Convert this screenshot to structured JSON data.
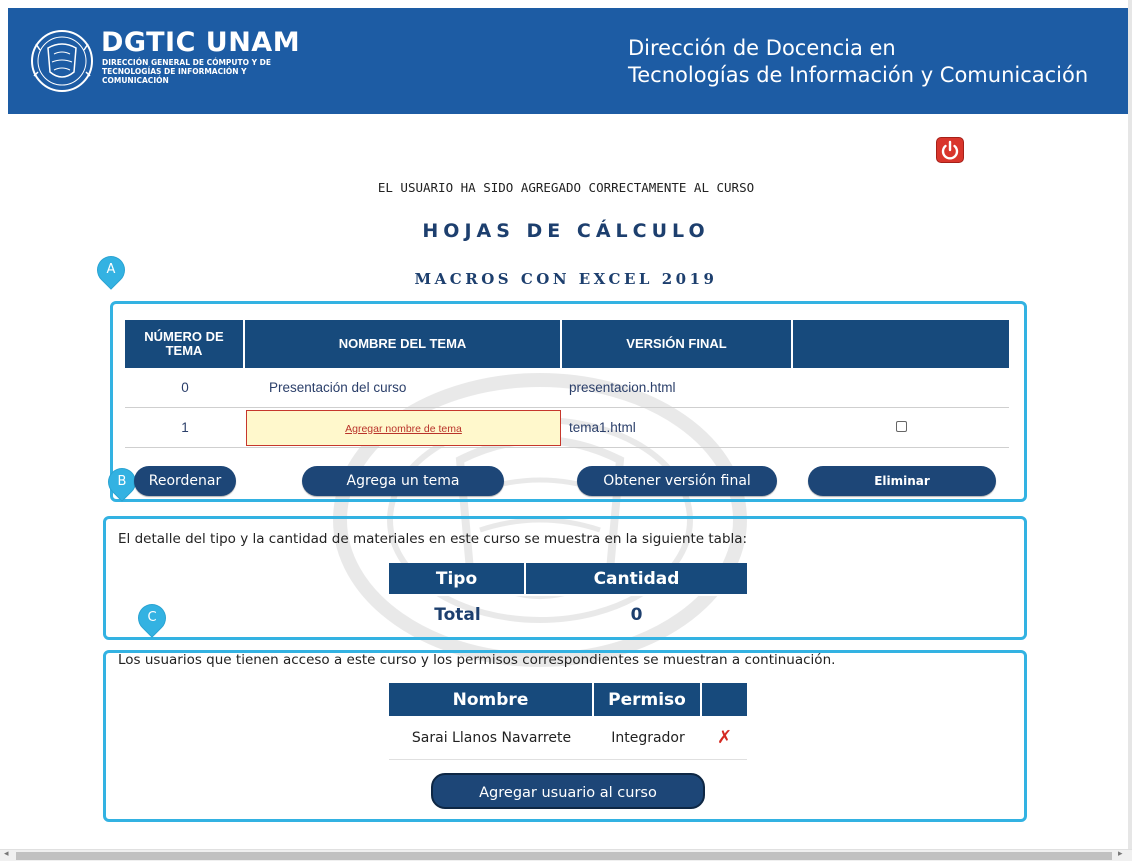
{
  "header": {
    "brand_title": "DGTIC UNAM",
    "brand_subtitle": "DIRECCIÓN GENERAL DE CÓMPUTO Y DE TECNOLOGÍAS DE INFORMACIÓN Y COMUNICACIÓN",
    "right_line1": "Dirección de Docencia en",
    "right_line2": "Tecnologías de Información y Comunicación",
    "background_color": "#1d5ca4"
  },
  "power_button": {
    "icon": "power-icon",
    "color": "#d9352c"
  },
  "status_message": "EL USUARIO HA SIDO AGREGADO CORRECTAMENTE AL CURSO",
  "course": {
    "title": "HOJAS DE CÁLCULO",
    "subtitle": "MACROS CON EXCEL 2019"
  },
  "markers": {
    "a": "A",
    "b": "B",
    "c": "C"
  },
  "topics_table": {
    "headers": [
      "NÚMERO DE TEMA",
      "NOMBRE DEL TEMA",
      "VERSIÓN FINAL",
      ""
    ],
    "rows": [
      {
        "number": "0",
        "name": "Presentación del curso",
        "final": "presentacion.html",
        "has_checkbox": false
      },
      {
        "number": "1",
        "name": "Agregar nombre de tema",
        "final": "tema1.html",
        "has_checkbox": true
      }
    ]
  },
  "actions": {
    "reorder": "Reordenar",
    "add_topic": "Agrega un tema",
    "final_version": "Obtener versión final",
    "delete": "Eliminar"
  },
  "materials": {
    "text": "El detalle del tipo y la cantidad de materiales en este curso se muestra en la siguiente tabla:",
    "headers": [
      "Tipo",
      "Cantidad"
    ],
    "total_label": "Total",
    "total_value": "0"
  },
  "users": {
    "text": "Los usuarios que tienen acceso a este curso y los permisos correspondientes se muestran a continuación.",
    "headers": [
      "Nombre",
      "Permiso",
      ""
    ],
    "rows": [
      {
        "name": "Sarai Llanos Navarrete",
        "permission": "Integrador"
      }
    ],
    "add_button": "Agregar usuario al curso"
  },
  "accent_color": "#33b2e2",
  "table_header_color": "#174a7c"
}
